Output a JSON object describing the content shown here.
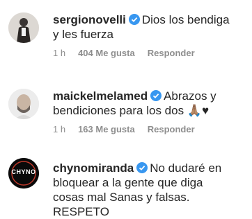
{
  "comments": [
    {
      "username": "sergionovelli",
      "verified": true,
      "text_line1": "Dios los bendiga",
      "text_line2": "y les fuerza",
      "time": "1 h",
      "likes": "404 Me gusta",
      "reply": "Responder"
    },
    {
      "username": "maickelmelamed",
      "verified": true,
      "text_line1": "Abrazos y",
      "text_line2": "bendiciones para los dos 🙏🏽♥",
      "time": "1 h",
      "likes": "163 Me gusta",
      "reply": "Responder"
    },
    {
      "username": "chynomiranda",
      "verified": true,
      "text_line1": "No dudaré en",
      "text_line2": "bloquear a la gente que diga",
      "text_line3": "cosas mal Sanas y falsas. RESPETO",
      "avatar_text": "CHYNO"
    }
  ],
  "colors": {
    "verified": "#3897f0",
    "meta": "#8e8e8e",
    "text": "#262626"
  }
}
